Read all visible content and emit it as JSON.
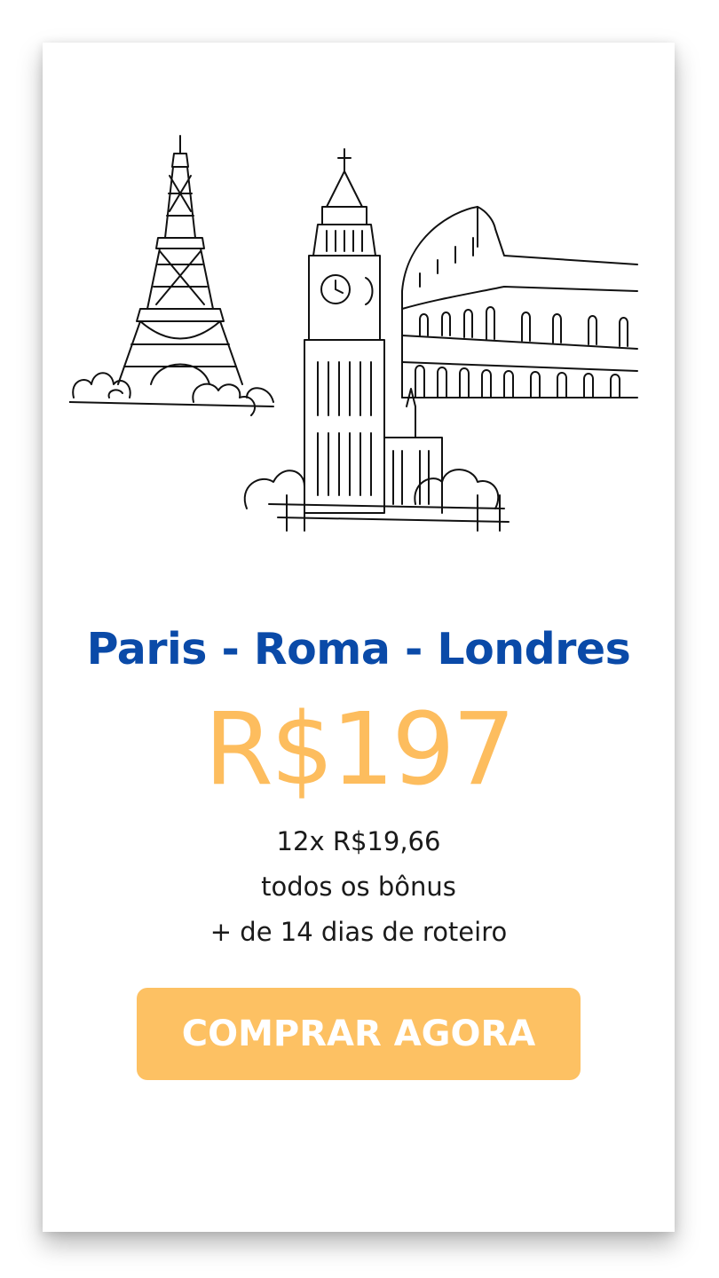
{
  "offer": {
    "title": "Paris - Roma - Londres",
    "price": "R$197",
    "details": [
      "12x R$19,66",
      "todos os bônus",
      "+ de 14 dias de roteiro"
    ],
    "cta_label": "COMPRAR AGORA"
  },
  "illustration": {
    "landmarks": [
      "eiffel-tower",
      "big-ben",
      "colosseum"
    ]
  },
  "colors": {
    "title": "#0a4aa8",
    "price": "#fdbd5e",
    "cta_background": "#fdc163",
    "cta_text": "#ffffff"
  }
}
